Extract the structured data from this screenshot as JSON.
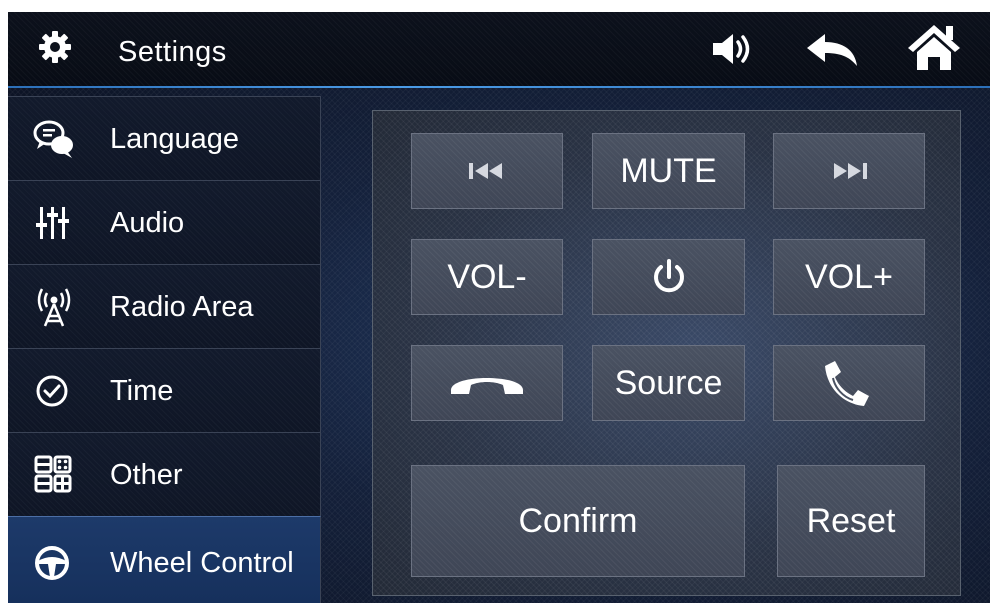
{
  "header": {
    "title": "Settings",
    "icons": {
      "settings": "gear-icon",
      "volume": "speaker-icon",
      "back": "back-arrow-icon",
      "home": "home-icon"
    }
  },
  "sidebar": {
    "items": [
      {
        "label": "Language",
        "icon": "chat-bubbles-icon",
        "active": false
      },
      {
        "label": "Audio",
        "icon": "equalizer-icon",
        "active": false
      },
      {
        "label": "Radio Area",
        "icon": "antenna-icon",
        "active": false
      },
      {
        "label": "Time",
        "icon": "clock-icon",
        "active": false
      },
      {
        "label": "Other",
        "icon": "grid-icon",
        "active": false
      },
      {
        "label": "Wheel Control",
        "icon": "steering-wheel-icon",
        "active": true
      }
    ]
  },
  "panel": {
    "keys": {
      "prev_icon": "previous-track-icon",
      "mute": "MUTE",
      "next_icon": "next-track-icon",
      "vol_down": "VOL-",
      "power_icon": "power-icon",
      "vol_up": "VOL+",
      "hangup_icon": "hang-up-icon",
      "source": "Source",
      "answer_icon": "answer-call-icon"
    },
    "confirm": "Confirm",
    "reset": "Reset"
  },
  "colors": {
    "header_line": "#4b9be6",
    "active_item": "#1d3a6a",
    "key_face": "#4a5262",
    "text": "#ffffff"
  }
}
